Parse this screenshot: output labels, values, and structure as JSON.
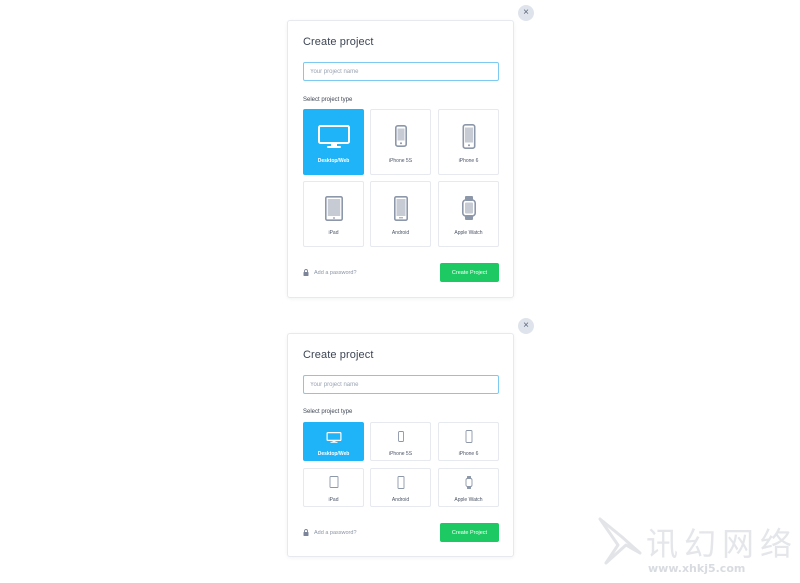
{
  "modals": [
    {
      "close_symbol": "×",
      "title": "Create project",
      "name_input": {
        "placeholder": "Your project name",
        "value": ""
      },
      "section_label": "Select project type",
      "project_types": [
        {
          "label": "Desktop/Web",
          "icon": "desktop-icon",
          "selected": true
        },
        {
          "label": "iPhone 5S",
          "icon": "iphone-5s-icon",
          "selected": false
        },
        {
          "label": "iPhone 6",
          "icon": "iphone-6-icon",
          "selected": false
        },
        {
          "label": "iPad",
          "icon": "ipad-icon",
          "selected": false
        },
        {
          "label": "Android",
          "icon": "android-icon",
          "selected": false
        },
        {
          "label": "Apple Watch",
          "icon": "apple-watch-icon",
          "selected": false
        }
      ],
      "password_link": "Add a password?",
      "create_button": "Create Project"
    },
    {
      "close_symbol": "×",
      "title": "Create project",
      "name_input": {
        "placeholder": "Your project name",
        "value": ""
      },
      "section_label": "Select project type",
      "project_types": [
        {
          "label": "Desktop/Web",
          "icon": "desktop-icon",
          "selected": true
        },
        {
          "label": "iPhone 5S",
          "icon": "iphone-5s-icon",
          "selected": false
        },
        {
          "label": "iPhone 6",
          "icon": "iphone-6-icon",
          "selected": false
        },
        {
          "label": "iPad",
          "icon": "ipad-icon",
          "selected": false
        },
        {
          "label": "Android",
          "icon": "android-icon",
          "selected": false
        },
        {
          "label": "Apple Watch",
          "icon": "apple-watch-icon",
          "selected": false
        }
      ],
      "password_link": "Add a password?",
      "create_button": "Create Project"
    }
  ],
  "watermark": {
    "brand_cn": "讯幻网络",
    "url": "www.xhkj5.com"
  },
  "colors": {
    "accent_blue": "#1fb3f7",
    "create_green": "#1dc962",
    "input_border": "#7ccaf2",
    "icon_gray": "#8d97aa"
  }
}
